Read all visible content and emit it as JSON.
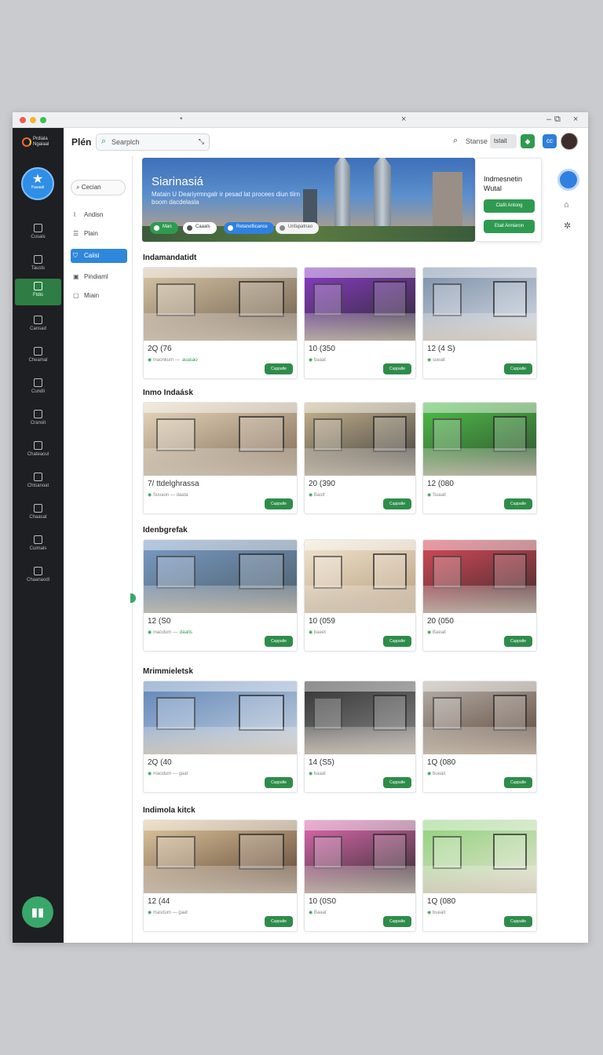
{
  "window": {
    "tab_dot": "•",
    "tab_close": "×",
    "controls": [
      "–",
      "⧉",
      "×"
    ]
  },
  "rail": {
    "logo_text": [
      "Prdiala",
      "Ngaiaal"
    ],
    "avatar_label": "Pasaati",
    "items": [
      {
        "label": "Cusais",
        "icon": "bag-icon"
      },
      {
        "label": "Tausts",
        "icon": "box-icon"
      },
      {
        "label": "Ftdis",
        "icon": "grid-icon",
        "active": true
      },
      {
        "label": "Cansad",
        "icon": "doc-icon"
      },
      {
        "label": "Cheamal",
        "icon": "clock-icon"
      },
      {
        "label": "Cundli",
        "icon": "doc-icon"
      },
      {
        "label": "Cranoit",
        "icon": "calendar-icon"
      },
      {
        "label": "Chateaoul",
        "icon": "globe-icon"
      },
      {
        "label": "Chtsanoat",
        "icon": "music-icon"
      },
      {
        "label": "Chaasat",
        "icon": "tag-icon"
      },
      {
        "label": "Cuimals",
        "icon": "doc-icon"
      },
      {
        "label": "Chaanaodl",
        "icon": "card-icon"
      }
    ]
  },
  "topbar": {
    "title": "Plén",
    "search_value": "Searplch",
    "right_search_label": "Stanse",
    "right_box_label": "tstait"
  },
  "subnav": {
    "search_label": "Cecian",
    "items": [
      {
        "label": "Andisn",
        "icon": "chart-icon"
      },
      {
        "label": "Plain",
        "icon": "list-icon"
      },
      {
        "label": "Caiisi",
        "icon": "cart-icon",
        "active": true
      },
      {
        "label": "Pindiaml",
        "icon": "box-icon"
      },
      {
        "label": "Miain",
        "icon": "card-icon"
      }
    ]
  },
  "hero": {
    "title": "Siarinasiá",
    "subtitle": "Matain U Deariyrmngalr ir pesad lat procees diun tiirn boom dacdelasla",
    "chips": [
      {
        "label": "Man",
        "bg": "#2e9a50",
        "color": "#ffffff",
        "dot": "#ffffff"
      },
      {
        "label": "Caaals",
        "bg": "#ffffff",
        "color": "#333333",
        "dot": "#555555"
      },
      {
        "label": "Retanoflicance",
        "bg": "#2f80e0",
        "color": "#ffffff",
        "dot": "#ffffff"
      },
      {
        "label": "Unfapatnao",
        "bg": "#f3f3f3",
        "color": "#555555",
        "dot": "#888888"
      }
    ]
  },
  "promo": {
    "title_line1": "Indmesnetin",
    "title_line2": "Wutal",
    "button1": "Clafit Antong",
    "button2": "Etait Anniaron"
  },
  "sections": [
    {
      "title": "Indamandatidt",
      "cards": [
        {
          "price": "2Q (76",
          "meta": "maonkum —",
          "meta_green": "auasao",
          "button": "Cuppalte",
          "palette": [
            "#d9c7a8",
            "#6b5a4a"
          ]
        },
        {
          "price": "10 (350",
          "meta": "baaat",
          "meta_green": "",
          "button": "Cuppalte",
          "palette": [
            "#8a3cc7",
            "#2a2a2a"
          ]
        },
        {
          "price": "12 (4 S)",
          "meta": "sueait",
          "meta_green": "",
          "button": "Cuppalte",
          "palette": [
            "#7b8ea8",
            "#d8dde5"
          ]
        }
      ]
    },
    {
      "title": "Inmo Indaásk",
      "cards": [
        {
          "price": "7/ ttdelghrassa",
          "meta": "Suvaon — daata",
          "meta_green": "",
          "button": "Cuppalte",
          "palette": [
            "#e8d9bf",
            "#7d6650"
          ]
        },
        {
          "price": "20 (390",
          "meta": "Bastt",
          "meta_green": "",
          "button": "Cuppalte",
          "palette": [
            "#c9b58f",
            "#3a3a3a"
          ]
        },
        {
          "price": "12 (080",
          "meta": "Suaait",
          "meta_green": "",
          "button": "Cuppalte",
          "palette": [
            "#4fbf4a",
            "#2f4a2e"
          ]
        }
      ]
    },
    {
      "title": "Idenbgrefak",
      "cards": [
        {
          "price": "12 (S0",
          "meta": "maodum —",
          "meta_green": "daatis",
          "button": "Cuppalte",
          "palette": [
            "#7a9cc6",
            "#4b5b66"
          ]
        },
        {
          "price": "10 (059",
          "meta": "baeet",
          "meta_green": "",
          "button": "Cuppalte",
          "palette": [
            "#f1e6d2",
            "#b79b7a"
          ]
        },
        {
          "price": "20 (050",
          "meta": "Baeait",
          "meta_green": "",
          "button": "Cuppalte",
          "palette": [
            "#d94a5a",
            "#3a2a2a"
          ]
        }
      ]
    },
    {
      "title": "Mrimmieletsk",
      "cards": [
        {
          "price": "2Q (40",
          "meta": "maodum — gaat",
          "meta_green": "",
          "button": "Cuppalte",
          "palette": [
            "#5f85b8",
            "#c9d3df"
          ]
        },
        {
          "price": "14 (S5)",
          "meta": "baaat",
          "meta_green": "",
          "button": "Cuppalte",
          "palette": [
            "#333333",
            "#8a8a8a"
          ]
        },
        {
          "price": "1Q (080",
          "meta": "bueait",
          "meta_green": "",
          "button": "Cuppalte",
          "palette": [
            "#b8b2aa",
            "#5a4236"
          ]
        }
      ]
    },
    {
      "title": "Indimola kitck",
      "cards": [
        {
          "price": "12 (44",
          "meta": "masdum — gaat",
          "meta_green": "",
          "button": "Cuppalte",
          "palette": [
            "#e0c9a0",
            "#5a4030"
          ]
        },
        {
          "price": "10 (0S0",
          "meta": "Baaat",
          "meta_green": "",
          "button": "Cuppalte",
          "palette": [
            "#e06ab0",
            "#2a2a2a"
          ]
        },
        {
          "price": "1Q (080",
          "meta": "bueait",
          "meta_green": "",
          "button": "Cuppalte",
          "palette": [
            "#8fd27a",
            "#e8e2d5"
          ]
        }
      ]
    }
  ]
}
